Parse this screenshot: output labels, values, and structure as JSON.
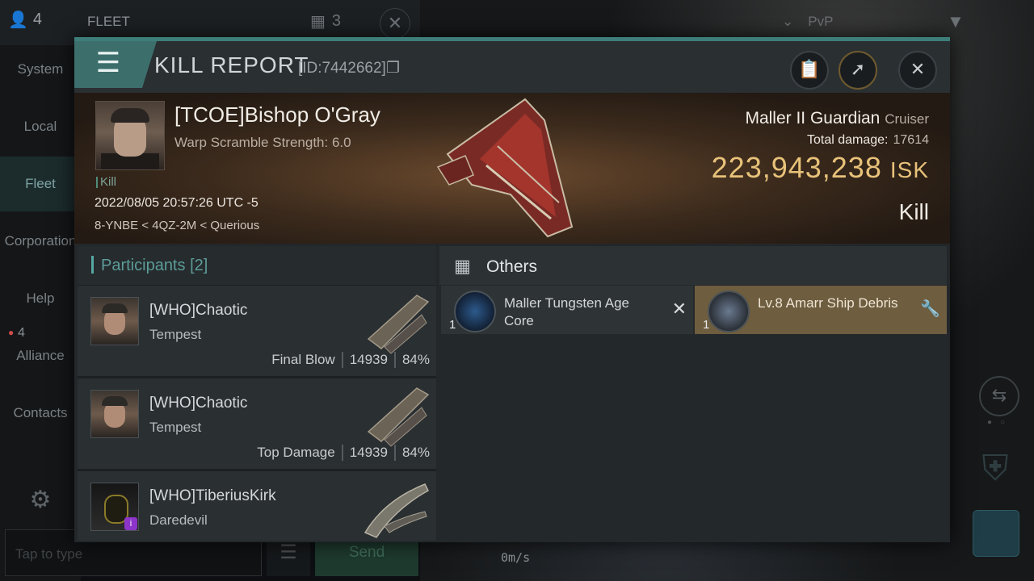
{
  "background": {
    "top": {
      "online_count": "4",
      "fleet_label": "FLEET",
      "members_count": "3",
      "pvp_label": "PvP"
    },
    "sidebar": [
      "System",
      "Local",
      "Fleet",
      "Corporation",
      "Help",
      "Alliance",
      "Contacts"
    ],
    "alliance_badge": "4",
    "chat": {
      "placeholder": "Tap to type",
      "send_label": "Send"
    },
    "speed": "0m/s"
  },
  "report": {
    "title": "KILL REPORT",
    "id_text": "[ID:7442662]",
    "victim": {
      "name": "[TCOE]Bishop O'Gray",
      "warp": "Warp Scramble Strength: 6.0",
      "tag": "Kill",
      "timestamp": "2022/08/05 20:57:26 UTC -5",
      "route": "8-YNBE < 4QZ-2M < Querious"
    },
    "ship": {
      "name": "Maller II Guardian",
      "class": "Cruiser",
      "damage_label": "Total damage:",
      "damage": "17614",
      "isk_value": "223,943,238",
      "isk_unit": "ISK",
      "result": "Kill"
    },
    "participants": {
      "label": "Participants",
      "count": "[2]",
      "rows": [
        {
          "name": "[WHO]Chaotic",
          "ship": "Tempest",
          "label": "Final Blow",
          "damage": "14939",
          "percent": "84%"
        },
        {
          "name": "[WHO]Chaotic",
          "ship": "Tempest",
          "label": "Top Damage",
          "damage": "14939",
          "percent": "84%"
        },
        {
          "name": "[WHO]TiberiusKirk",
          "ship": "Daredevil"
        }
      ]
    },
    "others": {
      "title": "Others",
      "items": [
        {
          "qty": "1",
          "name": "Maller Tungsten Age Core"
        },
        {
          "qty": "1",
          "name": "Lv.8 Amarr Ship Debris"
        }
      ]
    }
  }
}
